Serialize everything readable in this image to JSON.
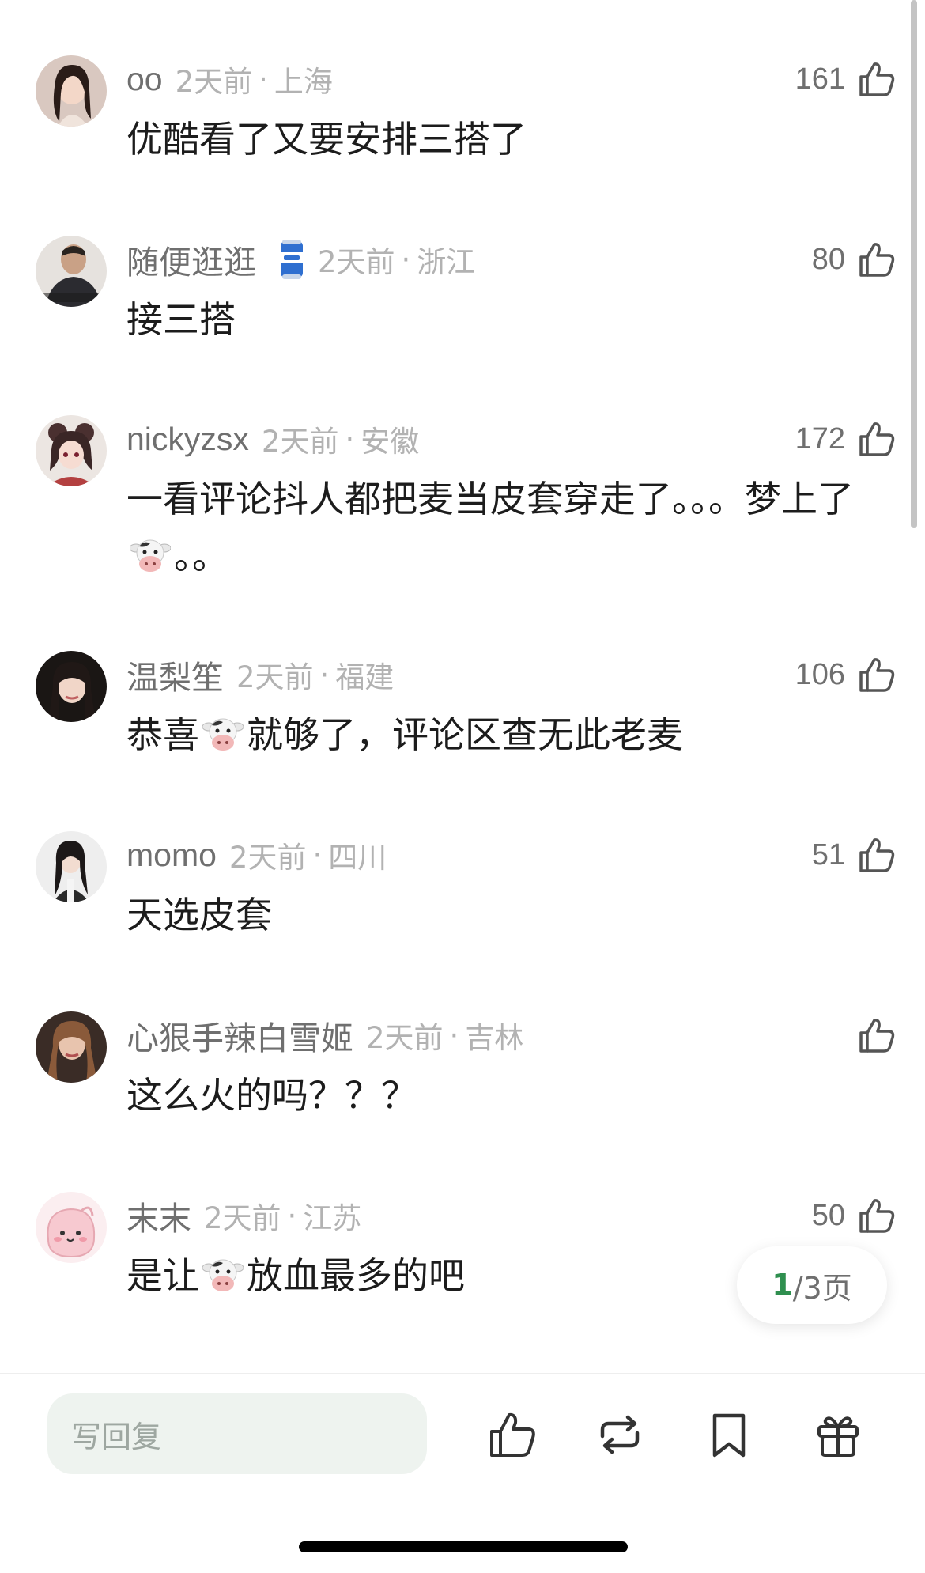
{
  "colors": {
    "username": "#6f6f6f",
    "meta": "#b2b2b2",
    "text": "#1c1c1c",
    "accent_green": "#2f8f4f",
    "input_bg": "#eef3ef"
  },
  "comments": [
    {
      "username": "oo",
      "time": "2天前",
      "sep": "·",
      "region": "上海",
      "likes": "161",
      "text": "优酷看了又要安排三搭了",
      "avatar_icon": "user-avatar-icon"
    },
    {
      "username": "随便逛逛",
      "badge_icon": "soda-can-badge-icon",
      "time": "2天前",
      "sep": "·",
      "region": "浙江",
      "likes": "80",
      "text": "接三搭",
      "avatar_icon": "user-avatar-icon"
    },
    {
      "username": "nickyzsx",
      "time": "2天前",
      "sep": "·",
      "region": "安徽",
      "likes": "172",
      "text_a": "一看评论抖人都把麦当皮套穿走了。。。梦上了",
      "text_b": "。。",
      "avatar_icon": "user-avatar-icon"
    },
    {
      "username": "温梨笙",
      "time": "2天前",
      "sep": "·",
      "region": "福建",
      "likes": "106",
      "text_a": "恭喜",
      "text_b": "就够了，评论区查无此老麦",
      "avatar_icon": "user-avatar-icon"
    },
    {
      "username": "momo",
      "time": "2天前",
      "sep": "·",
      "region": "四川",
      "likes": "51",
      "text": "天选皮套",
      "avatar_icon": "user-avatar-icon"
    },
    {
      "username": "心狠手辣白雪姬",
      "time": "2天前",
      "sep": "·",
      "region": "吉林",
      "likes": "",
      "text": "这么火的吗？？？",
      "avatar_icon": "user-avatar-icon"
    },
    {
      "username": "末末",
      "time": "2天前",
      "sep": "·",
      "region": "江苏",
      "likes": "50",
      "text_a": "是让",
      "text_b": "放血最多的吧",
      "avatar_icon": "user-avatar-icon"
    }
  ],
  "pager": {
    "current": "1",
    "rest": "/3页"
  },
  "reply": {
    "placeholder": "写回复"
  },
  "actions": [
    "thumbs-up-icon",
    "repost-icon",
    "bookmark-icon",
    "gift-icon"
  ]
}
